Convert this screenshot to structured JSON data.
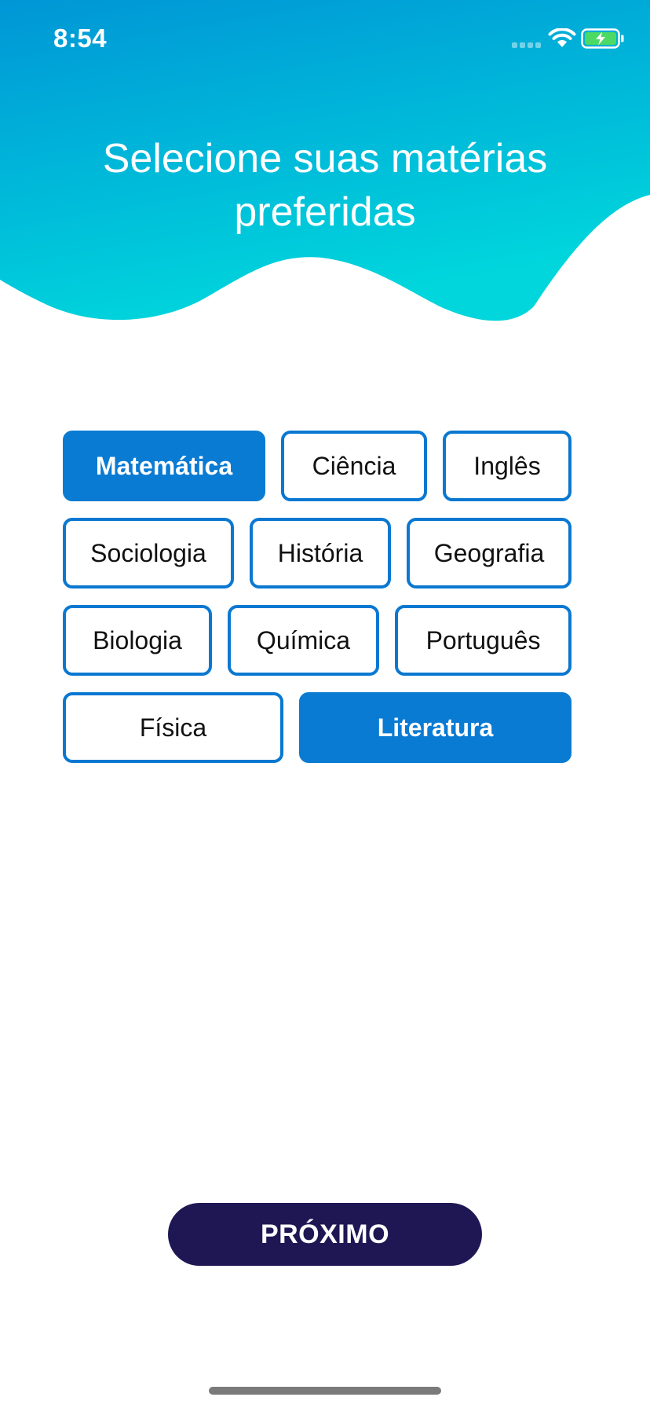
{
  "status_bar": {
    "time": "8:54"
  },
  "header": {
    "title_line1": "Selecione suas matérias",
    "title_line2": "preferidas"
  },
  "subjects": [
    {
      "label": "Matemática",
      "selected": true
    },
    {
      "label": "Ciência",
      "selected": false
    },
    {
      "label": "Inglês",
      "selected": false
    },
    {
      "label": "Sociologia",
      "selected": false
    },
    {
      "label": "História",
      "selected": false
    },
    {
      "label": "Geografia",
      "selected": false
    },
    {
      "label": "Biologia",
      "selected": false
    },
    {
      "label": "Química",
      "selected": false
    },
    {
      "label": "Português",
      "selected": false
    },
    {
      "label": "Física",
      "selected": false
    },
    {
      "label": "Literatura",
      "selected": true
    }
  ],
  "next_button": {
    "label": "PRÓXIMO"
  },
  "colors": {
    "header_gradient_start": "#0096d6",
    "header_gradient_end": "#00d6dc",
    "chip_border": "#0a78d1",
    "chip_selected": "#0a7bd3",
    "next_button_bg": "#1e1754",
    "battery": "#4cd964"
  },
  "icons": {
    "signal": "cellular-signal-icon",
    "wifi": "wifi-icon",
    "battery": "battery-charging-icon"
  }
}
